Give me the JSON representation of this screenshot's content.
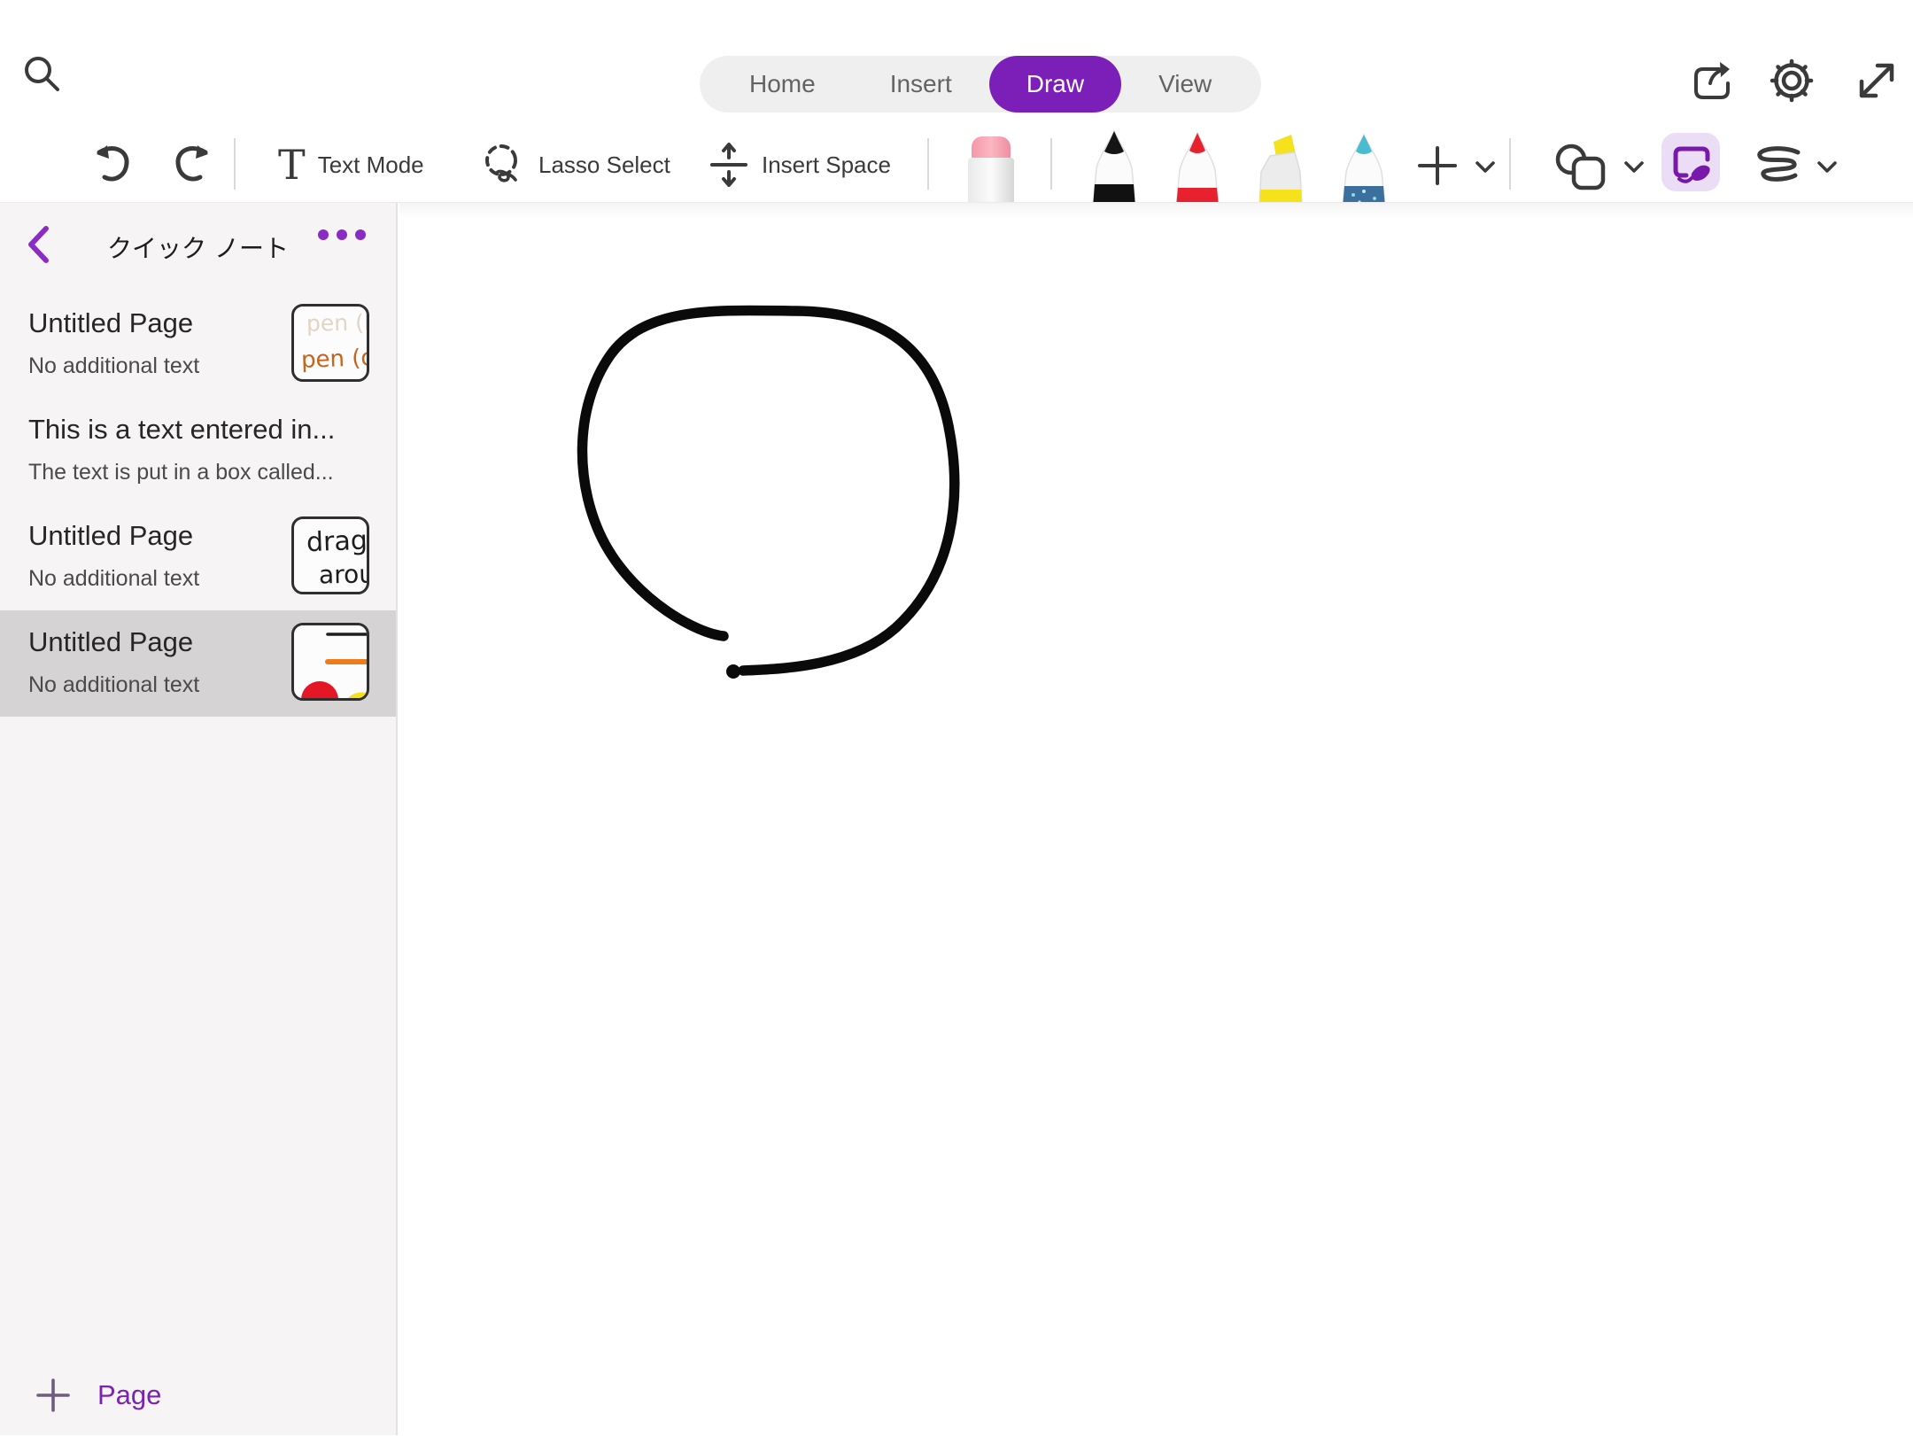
{
  "header": {
    "tabs": [
      {
        "label": "Home"
      },
      {
        "label": "Insert"
      },
      {
        "label": "Draw"
      },
      {
        "label": "View"
      }
    ],
    "active_tab": "Draw"
  },
  "toolbar": {
    "text_mode_label": "Text Mode",
    "lasso_select_label": "Lasso Select",
    "insert_space_label": "Insert Space",
    "tools": [
      {
        "name": "eraser"
      },
      {
        "name": "black-pen",
        "color": "#1c1c1e"
      },
      {
        "name": "red-pen",
        "color": "#e8212e"
      },
      {
        "name": "yellow-highlighter",
        "color": "#f5e11c"
      },
      {
        "name": "teal-pen",
        "color": "#49bcd0"
      }
    ]
  },
  "sidebar": {
    "title": "クイック ノート",
    "pages": [
      {
        "title": "Untitled Page",
        "subtitle": "No additional text",
        "thumb_line1": "pen (b",
        "thumb_line2": "pen (ora",
        "selected": false
      },
      {
        "title": "This is a text entered in...",
        "subtitle": "The text is put in a box called...",
        "selected": false
      },
      {
        "title": "Untitled Page",
        "subtitle": "No additional text",
        "thumb_line1": "drag",
        "thumb_line2": "arou",
        "selected": false
      },
      {
        "title": "Untitled Page",
        "subtitle": "No additional text",
        "selected": true
      }
    ],
    "add_page_label": "Page"
  },
  "canvas": {
    "ink_strokes": [
      {
        "type": "freehand-circle",
        "color": "#000000"
      }
    ]
  },
  "colors": {
    "accent_purple": "#7C1FB8",
    "accent_purple_light": "#ECDDF7",
    "selected_row": "#D5D3D4",
    "sidebar_bg": "#F6F4F5",
    "tab_pill_bg": "#EFEFEF",
    "toolbar_icon": "#3A3A3A",
    "thumb_orange": "#C4641D",
    "thumb_faded": "#E3D5C6",
    "ink_black": "#0A0A0A"
  }
}
